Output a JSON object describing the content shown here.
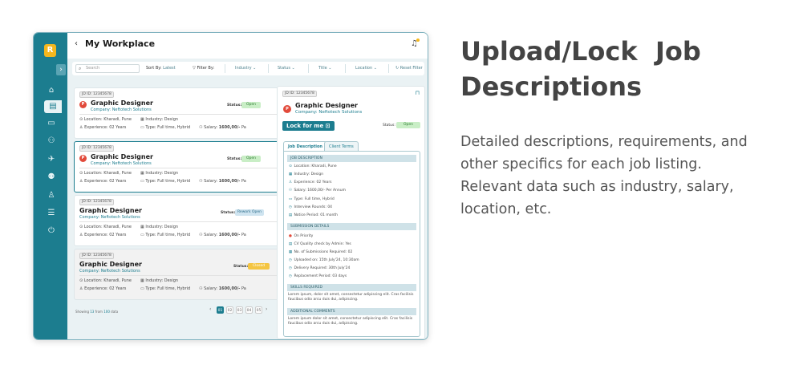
{
  "app": {
    "logo_letter": "R",
    "title": "My Workplace",
    "back_glyph": "‹",
    "expand_glyph": "›"
  },
  "sidebar": {
    "items": [
      {
        "icon": "home-icon",
        "glyph": "⌂"
      },
      {
        "icon": "jobs-icon",
        "glyph": "▤",
        "active": true
      },
      {
        "icon": "briefcase-icon",
        "glyph": "▭"
      },
      {
        "icon": "team-icon",
        "glyph": "⚇"
      },
      {
        "icon": "rocket-icon",
        "glyph": "✈"
      },
      {
        "icon": "users-icon",
        "glyph": "⚉"
      },
      {
        "icon": "profile-icon",
        "glyph": "♙"
      },
      {
        "icon": "list-icon",
        "glyph": "☰"
      },
      {
        "icon": "power-icon",
        "glyph": "⏻"
      }
    ]
  },
  "filters": {
    "search_placeholder": "Search",
    "sort_label": "Sort By:",
    "sort_value": "Latest",
    "filter_label": "Filter By:",
    "industry": "Industry",
    "status": "Status",
    "title": "Title",
    "location": "Location",
    "reset": "Reset Filter"
  },
  "jobs": [
    {
      "id": "JD ID: 12345678",
      "title": "Graphic Designer",
      "company": "Company: Neftotech Solutions",
      "status_label": "Status:",
      "status": "Open",
      "location": "Location: Kharadi, Pune",
      "industry": "Industry: Design",
      "experience": "Experience: 02 Years",
      "type": "Type: Full time, Hybrid",
      "salary_label": "Salary:",
      "salary": "1600,00/-",
      "salary_unit": "Pa",
      "logo_letter": "P"
    },
    {
      "id": "JD ID: 12345678",
      "title": "Graphic Designer",
      "company": "Company: Neftotech Solutions",
      "status_label": "Status:",
      "status": "Open",
      "location": "Location: Kharadi, Pune",
      "industry": "Industry: Design",
      "experience": "Experience: 02 Years",
      "type": "Type: Full time, Hybrid",
      "salary_label": "Salary:",
      "salary": "1600,00/-",
      "salary_unit": "Pa",
      "logo_letter": "P"
    },
    {
      "id": "JD ID: 12345678",
      "title": "Graphic Designer",
      "company": "Company: Neftotech Solutions",
      "status_label": "Status:",
      "status": "Rework Open",
      "location": "Location: Kharadi, Pune",
      "industry": "Industry: Design",
      "experience": "Experience: 02 Years",
      "type": "Type: Full time, Hybrid",
      "salary_label": "Salary:",
      "salary": "1600,00/-",
      "salary_unit": "Pa"
    },
    {
      "id": "JD ID: 12345678",
      "title": "Graphic Designer",
      "company": "Company: Neftotech Solutions",
      "status_label": "Status:",
      "status": "Closed",
      "location": "Location: Kharadi, Pune",
      "industry": "Industry: Design",
      "experience": "Experience: 02 Years",
      "type": "Type: Full time, Hybrid",
      "salary_label": "Salary:",
      "salary": "1600,00/-",
      "salary_unit": "Pa"
    }
  ],
  "pagination": {
    "showing_prefix": "Showing",
    "showing_count": "13",
    "showing_mid": "from",
    "showing_total": "100",
    "showing_suffix": "data",
    "prev": "‹",
    "next": "›",
    "pages": [
      "01",
      "02",
      "03",
      "04",
      "05"
    ],
    "current": "01"
  },
  "detail": {
    "id": "JD ID: 12345678",
    "title": "Graphic Designer",
    "company": "Company: Neftotech Solutions",
    "logo_letter": "P",
    "lock_button": "Lock for me",
    "status_label": "Status:",
    "status": "Open",
    "tabs": [
      "Job Description",
      "Client Terms"
    ],
    "job_description_heading": "JOB DESCRIPTION",
    "job_rows": [
      "Location: Kharadi, Pune",
      "Industry: Design",
      "Experience: 02 Years",
      "Salary: 1600,00/- Per Annum",
      "Type: Full time, Hybrid",
      "Interview Rounds: 04",
      "Notice Period: 01 month"
    ],
    "submission_heading": "SUBMISSION DETAILS",
    "submission_rows": [
      "On Priority",
      "CV Quality check by Admin: Yes",
      "No. of Submissions Required: 02",
      "Uploaded on: 15th July'24, 10:30am",
      "Delivery Required: 30th July'24",
      "Replacement Period: 03 days"
    ],
    "skills_heading": "SKILLS REQUIRED",
    "skills_text": "Lorem ipsum, dolor sit amet, consectetur adipiscing elit. Cras facilisis faucibus odio arcu duis dui, adipiscing.",
    "comments_heading": "ADDITIONAL COMMENTS",
    "comments_text": "Lorem ipsum dolor sit amet, consectetur adipiscing elit. Cras facilisis faucibus odio arcu duis dui, adipiscing."
  },
  "marketing": {
    "title_line1": "Upload/Lock  Job",
    "title_line2": "Descriptions",
    "desc_line1": "Detailed descriptions, requirements, and",
    "desc_line2": "other specifics for each job listing.",
    "desc_line3": "Relevant data such as industry, salary,",
    "desc_line4": "location, etc."
  }
}
